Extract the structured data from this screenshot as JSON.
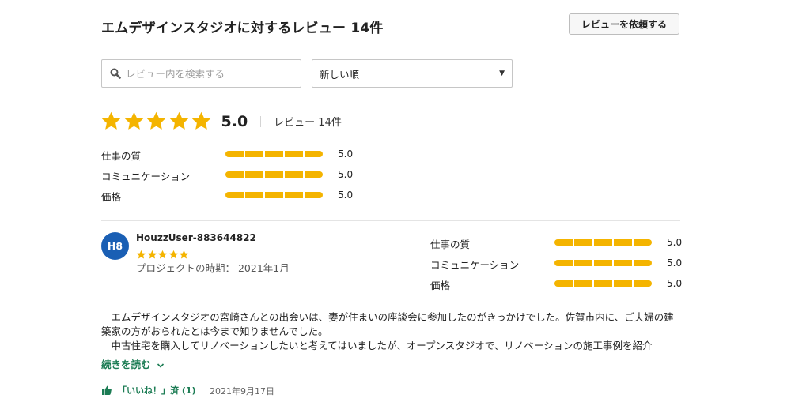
{
  "header": {
    "title": "エムデザインスタジオに対するレビュー 14件",
    "request_button": "レビューを依頼する"
  },
  "search": {
    "placeholder": "レビュー内を検索する"
  },
  "sort": {
    "selected": "新しい順"
  },
  "overall": {
    "stars": 5,
    "score": "5.0",
    "review_count": "レビュー 14件"
  },
  "categories": [
    {
      "label": "仕事の質",
      "value": "5.0",
      "fill": 1.0
    },
    {
      "label": "コミュニケーション",
      "value": "5.0",
      "fill": 1.0
    },
    {
      "label": "価格",
      "value": "5.0",
      "fill": 1.0
    }
  ],
  "review": {
    "avatar_initials": "H8",
    "user": "HouzzUser-883644822",
    "stars": 5,
    "project_date": "プロジェクトの時期： 2021年1月",
    "categories": [
      {
        "label": "仕事の質",
        "value": "5.0",
        "fill": 1.0
      },
      {
        "label": "コミュニケーション",
        "value": "5.0",
        "fill": 1.0
      },
      {
        "label": "価格",
        "value": "5.0",
        "fill": 1.0
      }
    ],
    "body": [
      "エムデザインスタジオの宮崎さんとの出会いは、妻が住まいの座談会に参加したのがきっかけでした。佐賀市内に、ご夫婦の建築家の方がおられたとは今まで知りませんでした。",
      "中古住宅を購入してリノベーションしたいと考えてはいましたが、オープンスタジオで、リノベーションの施工事例を紹介"
    ],
    "read_more": "続きを読む",
    "like_label": "「いいね！」済 (1)",
    "posted": "2021年9月17日"
  },
  "colors": {
    "star": "#f4b400",
    "accent_green": "#1c7c54",
    "avatar_bg": "#1a5fb4"
  },
  "icons": {
    "search": "search-icon",
    "sort_caret": "caret-down-icon",
    "star": "star-icon",
    "like": "thumbs-up-icon",
    "read_more": "chevron-down-icon"
  }
}
